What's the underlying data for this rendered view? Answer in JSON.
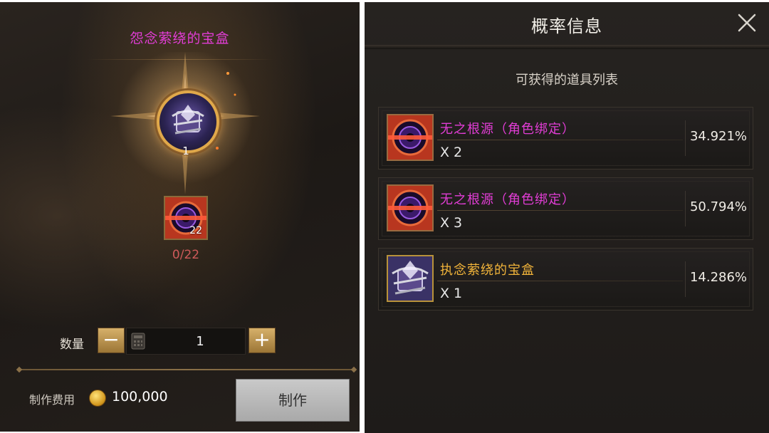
{
  "craft": {
    "title": "怨念萦绕的宝盒",
    "main_item_count": "1",
    "material_count": "22",
    "material_progress": "0/22",
    "quantity_label": "数量",
    "quantity_value": "1",
    "decrease_label": "−",
    "increase_label": "+",
    "cost_label": "制作费用",
    "cost_value": "100,000",
    "craft_button": "制作"
  },
  "probability": {
    "title": "概率信息",
    "list_heading": "可获得的道具列表",
    "items": [
      {
        "name": "无之根源（角色绑定）",
        "quantity": "X 2",
        "percent": "34.921%",
        "name_color": "#e23dd6",
        "icon": "portal-rune-icon"
      },
      {
        "name": "无之根源（角色绑定）",
        "quantity": "X 3",
        "percent": "50.794%",
        "name_color": "#e23dd6",
        "icon": "portal-rune-icon"
      },
      {
        "name": "执念萦绕的宝盒",
        "quantity": "X 1",
        "percent": "14.286%",
        "name_color": "#f2b43a",
        "icon": "chained-box-icon"
      }
    ]
  }
}
